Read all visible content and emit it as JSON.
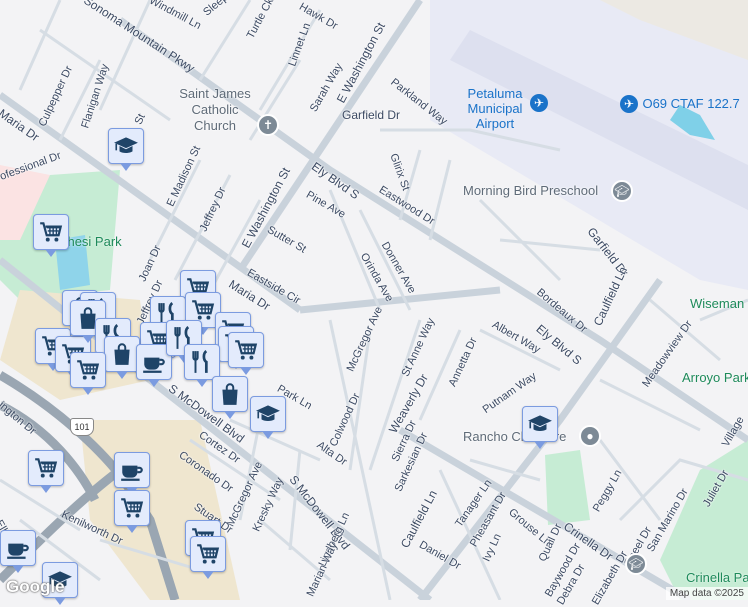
{
  "streets": [
    "Sonoma Mountain Pkwy",
    "Windmill Ln",
    "Sleepy",
    "Turtle Ck",
    "Hawk Dr",
    "Linnet Ln",
    "Sarah Way",
    "E Washington St",
    "Parkland Way",
    "Garfield Dr",
    "Culpepper Dr",
    "Flanigan Way",
    "Maria Dr",
    "Professional Dr",
    "E Madison St",
    "Jeffrey Dr",
    "E Washington St",
    "Ely Blvd S",
    "Pine Ave",
    "Sutter St",
    "Eastside Cir",
    "Maria Dr",
    "Joan Dr",
    "Orinda Ave",
    "Donner Ave",
    "Glirix St",
    "Eastwood Dr",
    "Garfield Dr",
    "Bordeaux Dr",
    "Caulfield Ln",
    "Ely Blvd S",
    "Albert Way",
    "Meadowview Dr",
    "Village",
    "McGregor Ave",
    "St Anne Way",
    "Annetta Dr",
    "Weaverly Dr",
    "Putnam Way",
    "Colwood Dr",
    "Sierra Dr",
    "Sarkesian Dr",
    "Caulfield Ln",
    "Tanager Ln",
    "Pheasant Dr",
    "Grouse Ln",
    "Ivy Ln",
    "Quail Dr",
    "Daniel Dr",
    "Baywood Dr",
    "Crinella Dr",
    "Peggy Ln",
    "Oneel Dr",
    "San Marino Dr",
    "Juliet Dr",
    "Alta Dr",
    "Park Ln",
    "S McDowell Blvd",
    "S McDowell Blvd",
    "Cortez Dr",
    "Coronado Dr",
    "McGregor Ave",
    "Kresky Way",
    "Lindberg Ln",
    "Marian Way",
    "Stuart Dr",
    "Kenilworth Dr",
    "Ellis St",
    "ington Dr",
    "Jeffrey Dr",
    "St",
    "Debra Dr",
    "Elizabeth Dr"
  ],
  "places": {
    "church": "Saint James Catholic Church",
    "airport": "Petaluma Municipal Airport",
    "airfield": "O69 CTAF 122.7",
    "preschool": "Morning Bird Preschool",
    "childcare": "Rancho Childcare"
  },
  "parks": [
    "Lucchesi Park",
    "Wiseman",
    "Arroyo Park",
    "Crinella Park"
  ],
  "highway": "101",
  "attribution": "Map data ©2025",
  "logo": "Google",
  "markers": [
    "school",
    "cart",
    "cart",
    "bag",
    "restaurant",
    "restaurant",
    "cart",
    "cart",
    "bag",
    "restaurant",
    "cart",
    "cart",
    "cart",
    "cart",
    "cart",
    "bag",
    "coffee",
    "restaurant",
    "restaurant",
    "cart",
    "bag",
    "school",
    "cart",
    "coffee",
    "cart",
    "cart",
    "cart",
    "coffee",
    "school",
    "school"
  ]
}
